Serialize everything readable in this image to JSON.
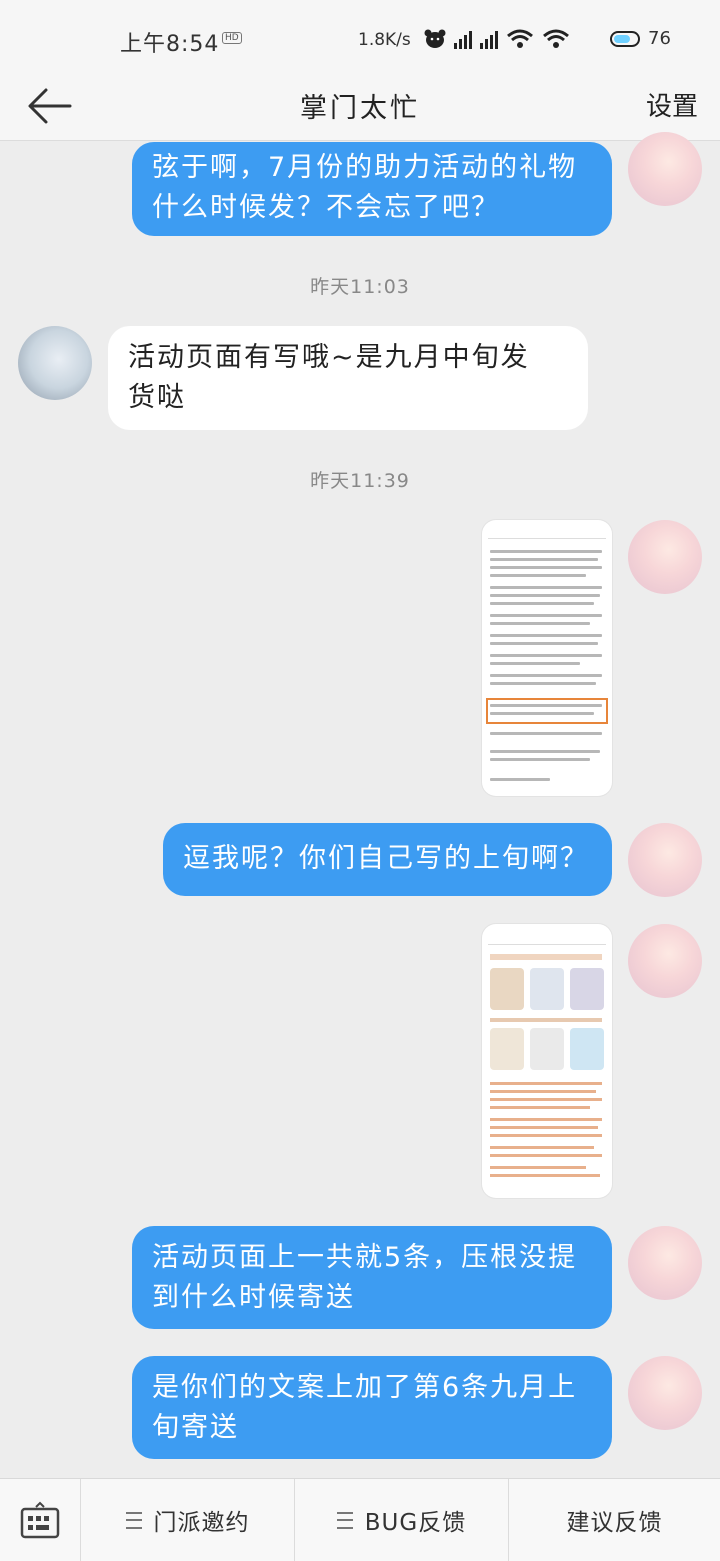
{
  "status_bar": {
    "time": "上午8:54",
    "badge": "HD",
    "speed": "1.8K/s",
    "battery": "76"
  },
  "header": {
    "title": "掌门太忙",
    "settings_label": "设置"
  },
  "messages": [
    {
      "text": "弦于啊，7月份的助力活动的礼物什么时候发？不会忘了吧？"
    },
    {
      "timestamp": "昨天11:03"
    },
    {
      "text": "活动页面有写哦~是九月中旬发货哒"
    },
    {
      "timestamp": "昨天11:39"
    },
    {
      "text": "逗我呢？你们自己写的上旬啊？"
    },
    {
      "text": "活动页面上一共就5条，压根没提到什么时候寄送"
    },
    {
      "text": "是你们的文案上加了第6条九月上旬寄送"
    }
  ],
  "bottom_bar": {
    "item1": "门派邀约",
    "item2": "BUG反馈",
    "item3": "建议反馈"
  },
  "colors": {
    "my_bubble": "#3d9cf2",
    "their_bubble": "#ffffff",
    "background": "#ededed",
    "highlight_box": "#e7853a"
  }
}
